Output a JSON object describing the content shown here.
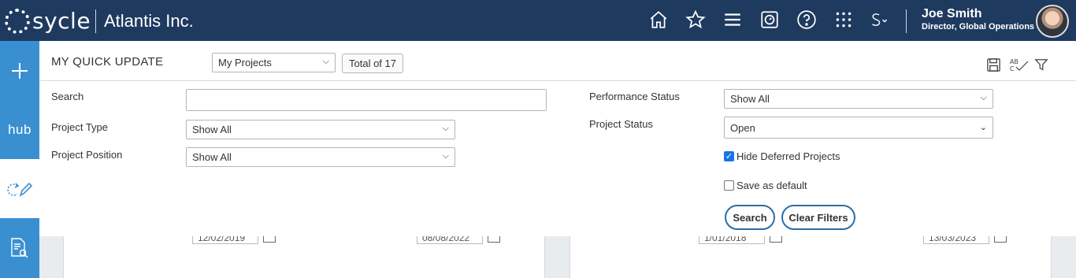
{
  "header": {
    "logo_text": "sycle",
    "company": "Atlantis Inc.",
    "user_name": "Joe Smith",
    "user_role": "Director, Global Operations",
    "icons": [
      "home-icon",
      "star-icon",
      "menu-icon",
      "timer-icon",
      "help-icon",
      "apps-grid-icon",
      "sycle-s-icon"
    ]
  },
  "sidebar": {
    "items": [
      {
        "name": "add",
        "label": "+"
      },
      {
        "name": "hub",
        "label": "hub"
      },
      {
        "name": "quick-update",
        "label": ""
      },
      {
        "name": "report-search",
        "label": ""
      }
    ]
  },
  "panel": {
    "title": "MY QUICK UPDATE",
    "projects_select": "My Projects",
    "total": "Total of 17"
  },
  "filters": {
    "search_label": "Search",
    "search_value": "",
    "project_type_label": "Project Type",
    "project_type_value": "Show All",
    "project_position_label": "Project Position",
    "project_position_value": "Show All",
    "performance_status_label": "Performance Status",
    "performance_status_value": "Show All",
    "project_status_label": "Project Status",
    "project_status_value": "Open",
    "hide_deferred_label": "Hide Deferred Projects",
    "hide_deferred_checked": true,
    "save_default_label": "Save as default",
    "save_default_checked": false,
    "search_button": "Search",
    "clear_button": "Clear Filters"
  },
  "background_dates": [
    "12/02/2019",
    "08/08/2022",
    "1/01/2018",
    "13/03/2023"
  ],
  "colors": {
    "header_bg": "#1f3a5f",
    "sidebar_bg": "#3a8fd1",
    "button_border": "#2c6da4",
    "checkbox_checked": "#1a73e8"
  }
}
